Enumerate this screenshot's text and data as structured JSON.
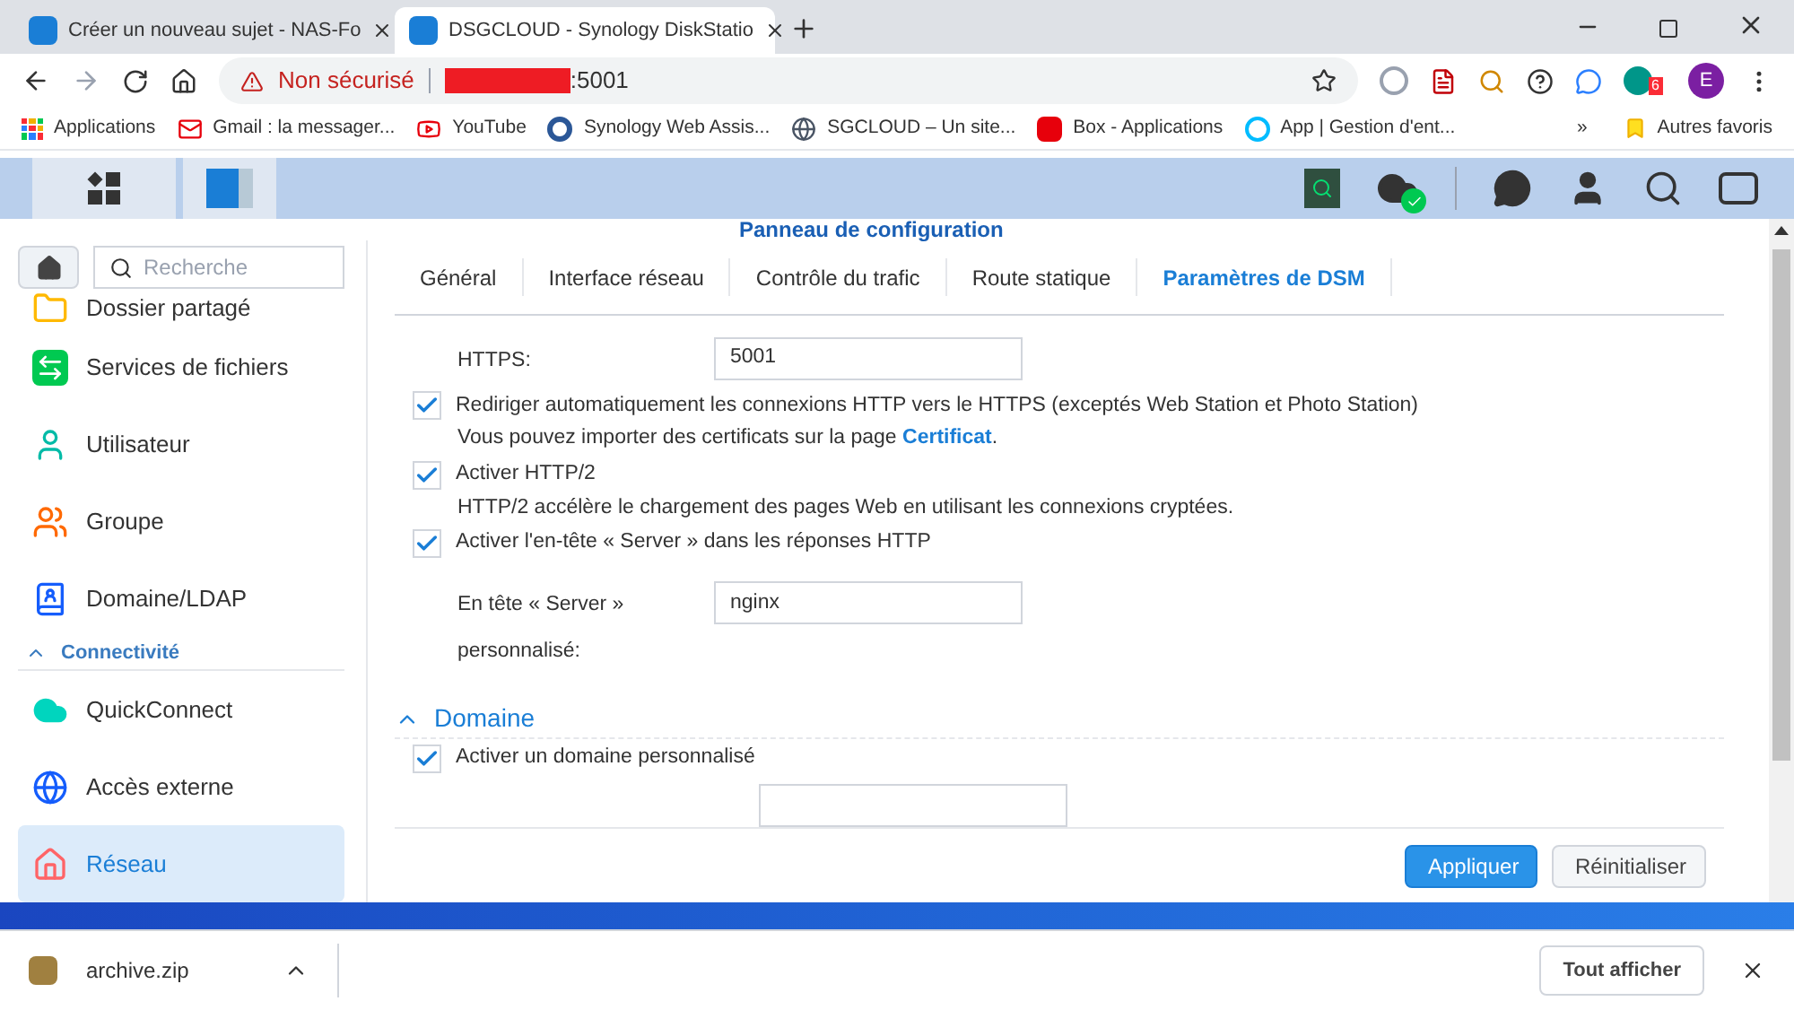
{
  "browser": {
    "tabs": [
      {
        "title": "Créer un nouveau sujet - NAS-Fo",
        "selected": false
      },
      {
        "title": "DSGCLOUD - Synology DiskStatio",
        "selected": true
      }
    ],
    "address": {
      "warning": "Non sécurisé",
      "port": ":5001"
    },
    "bookmarks": [
      {
        "label": "Applications"
      },
      {
        "label": "Gmail : la messager..."
      },
      {
        "label": "YouTube"
      },
      {
        "label": "Synology Web Assis..."
      },
      {
        "label": "SGCLOUD – Un site..."
      },
      {
        "label": "Box - Applications"
      },
      {
        "label": "App | Gestion d'ent..."
      }
    ],
    "more": "»",
    "other_bookmarks": "Autres favoris",
    "profile": "E",
    "badge": "6"
  },
  "dsm": {
    "window_title": "Panneau de configuration",
    "search": {
      "placeholder": "Recherche"
    },
    "sidebar": [
      {
        "kind": "item",
        "label": "Dossier partagé",
        "selected": false
      },
      {
        "kind": "item",
        "label": "Services de fichiers",
        "selected": false
      },
      {
        "kind": "item",
        "label": "Utilisateur",
        "selected": false
      },
      {
        "kind": "item",
        "label": "Groupe",
        "selected": false
      },
      {
        "kind": "item",
        "label": "Domaine/LDAP",
        "selected": false
      },
      {
        "kind": "section",
        "label": "Connectivité",
        "expanded": true
      },
      {
        "kind": "item",
        "label": "QuickConnect",
        "selected": false
      },
      {
        "kind": "item",
        "label": "Accès externe",
        "selected": false
      },
      {
        "kind": "item",
        "label": "Réseau",
        "selected": true
      }
    ],
    "tabs": [
      {
        "label": "Général",
        "selected": false
      },
      {
        "label": "Interface réseau",
        "selected": false
      },
      {
        "label": "Contrôle du trafic",
        "selected": false
      },
      {
        "label": "Route statique",
        "selected": false
      },
      {
        "label": "Paramètres de DSM",
        "selected": true
      }
    ],
    "rows": [
      {
        "kind": "field",
        "label": "HTTPS:",
        "value": "5001"
      },
      {
        "kind": "checkbox",
        "label": "Rediriger automatiquement les connexions HTTP vers le HTTPS (exceptés Web Station et Photo Station)",
        "checked": true
      },
      {
        "kind": "note",
        "text": "Vous pouvez importer des certificats sur la page ",
        "link": "Certificat",
        "after": "."
      },
      {
        "kind": "checkbox",
        "label": "Activer HTTP/2",
        "checked": true
      },
      {
        "kind": "note",
        "text": "HTTP/2 accélère le chargement des pages Web en utilisant les connexions cryptées."
      },
      {
        "kind": "checkbox",
        "label": "Activer l'en-tête « Server » dans les réponses HTTP",
        "checked": true
      },
      {
        "kind": "field",
        "label": "En tête « Server » personnalisé:",
        "value": "nginx"
      },
      {
        "kind": "section",
        "label": "Domaine",
        "expanded": true
      },
      {
        "kind": "checkbox",
        "label": "Activer un domaine personnalisé",
        "checked": true
      }
    ],
    "buttons": [
      {
        "label": "Appliquer",
        "kind": "primary"
      },
      {
        "label": "Réinitialiser",
        "kind": "secondary"
      }
    ]
  },
  "downloads": {
    "file": "archive.zip",
    "show_all": "Tout afficher"
  }
}
